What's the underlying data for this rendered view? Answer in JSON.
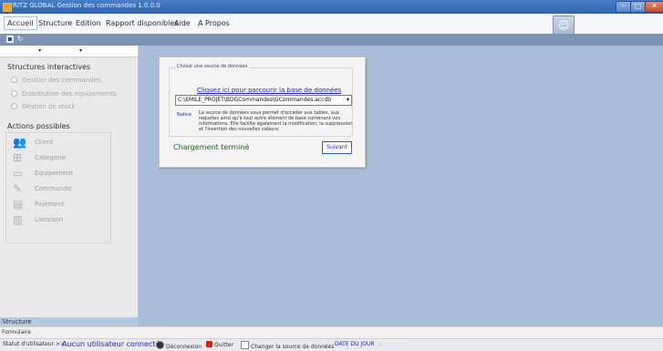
{
  "window": {
    "title": "RITZ GLOBAL  Gestion des commandes  1.0.0.0",
    "controls": {
      "minimize": "–",
      "maximize": "□",
      "close": "✕"
    }
  },
  "menu": {
    "items": [
      "Accueil",
      "Structure",
      "Edition",
      "Rapport disponibles",
      "Aide",
      "A Propos"
    ],
    "active": "Accueil"
  },
  "toolbar": {
    "icons": [
      "save-icon",
      "refresh-icon"
    ]
  },
  "left_panel": {
    "dropdown1_arrow": "▾",
    "dropdown2_arrow": "▾",
    "structures_title": "Structures interactives",
    "structures": [
      "Gestion des commandes",
      "Distribution des equipements",
      "Gestion de stock"
    ],
    "actions_title": "Actions possibles",
    "actions": [
      {
        "label": "Client",
        "icon": "client-icon"
      },
      {
        "label": "Categorie",
        "icon": "categorie-icon"
      },
      {
        "label": "Equipement",
        "icon": "equipement-icon"
      },
      {
        "label": "Commande",
        "icon": "commande-icon"
      },
      {
        "label": "Paiement",
        "icon": "paiement-icon"
      },
      {
        "label": "Livraison",
        "icon": "livraison-icon"
      }
    ]
  },
  "dialog": {
    "group_legend": "Choisir une source de données",
    "link_text": "Cliquez ici pour parcourir la base de données",
    "path_value": "C:\\EMILE_PROJET\\BDGCommandes\\GCommandes.accdb",
    "path_arrow": "▾",
    "notice_label": "Notice",
    "notice_text": "La source de données vous permet d'accéder aux tables, aux requetes ainsi qu'à tout autre élément de base contenant vos informations. Elle facilite également la modification, la suppression et l'insertion des nouvelles valeurs.",
    "status": "Chargement terminé",
    "next_button": "Suivant"
  },
  "bottom": {
    "structure_label": "Structure",
    "form_label": "Formulaire",
    "status_prefix": "Statut d'utilisateur >>",
    "user_status": "Aucun utilisateur connecté",
    "logout": "Déconnexion",
    "quit": "Quitter",
    "change_source": "Changer la source de données",
    "date_label": "DATE DU JOUR",
    "date_sep": ":",
    "date_value": "24/08/2014"
  }
}
